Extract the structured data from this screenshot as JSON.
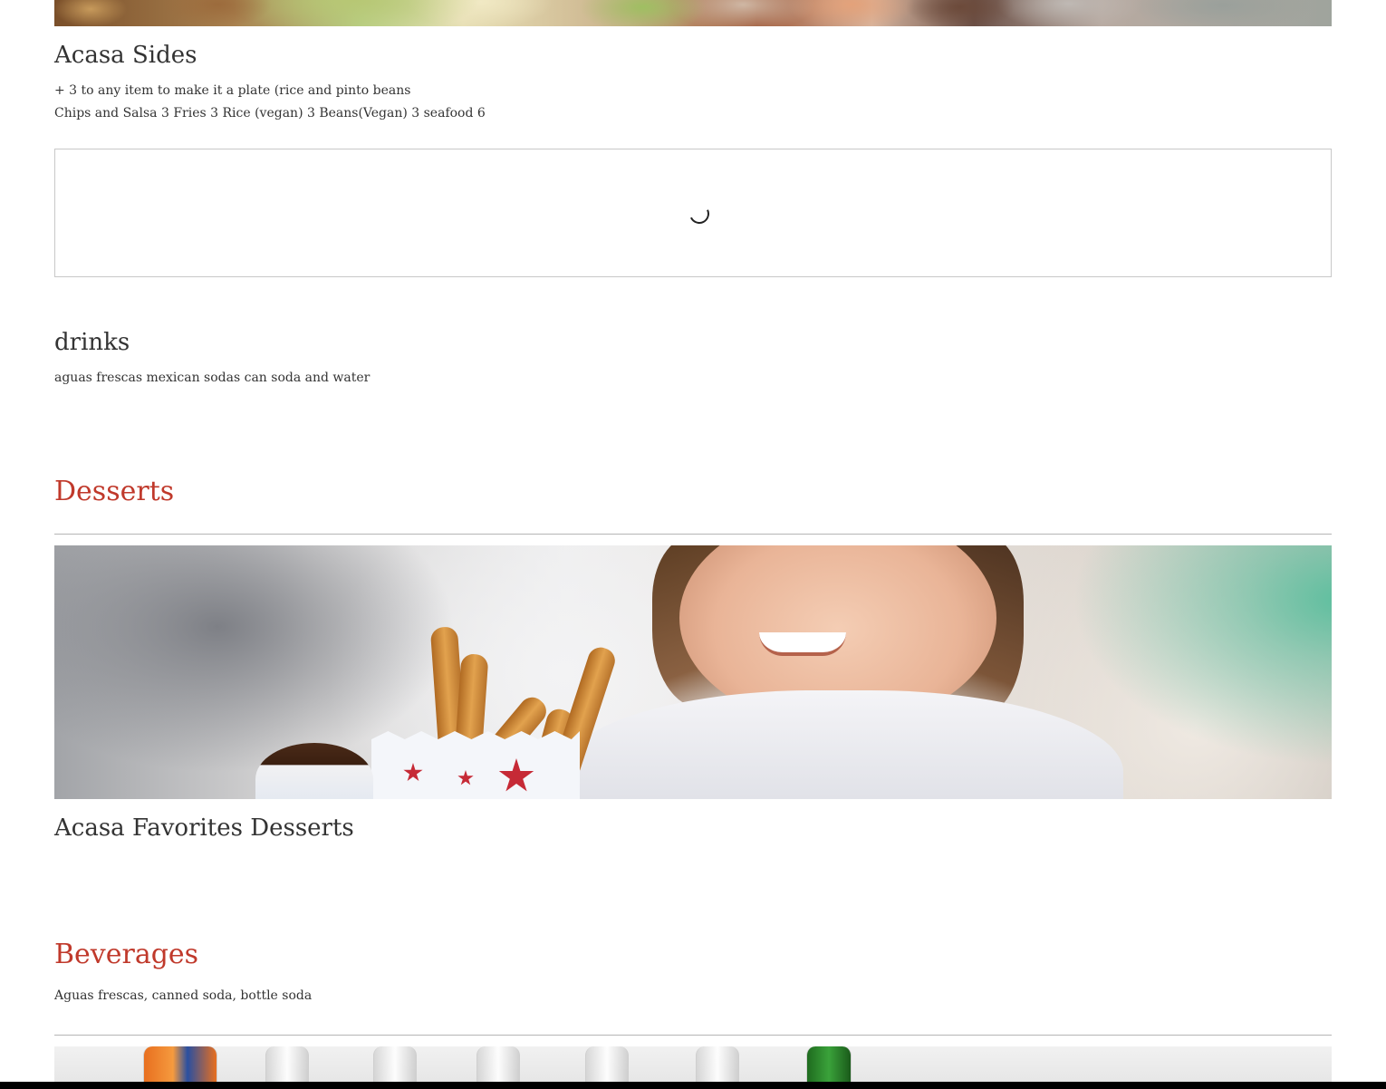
{
  "menu": {
    "sides": {
      "title": "Acasa Sides",
      "desc_line1": "+ 3 to any item to make it a plate (rice and pinto beans",
      "desc_line2": "Chips and Salsa 3 Fries 3 Rice (vegan) 3 Beans(Vegan) 3 seafood 6"
    },
    "drinks": {
      "title": "drinks",
      "desc": "aguas frescas mexican sodas can soda and water"
    }
  },
  "categories": {
    "desserts": {
      "title": "Desserts",
      "section_title": "Acasa Favorites Desserts"
    },
    "beverages": {
      "title": "Beverages",
      "desc": "Aguas frescas, canned soda, bottle soda"
    }
  },
  "colors": {
    "category_accent": "#c0392b",
    "text": "#333333",
    "divider": "#b5b5b5"
  },
  "icons": {
    "loading": "loading-spinner-icon"
  }
}
